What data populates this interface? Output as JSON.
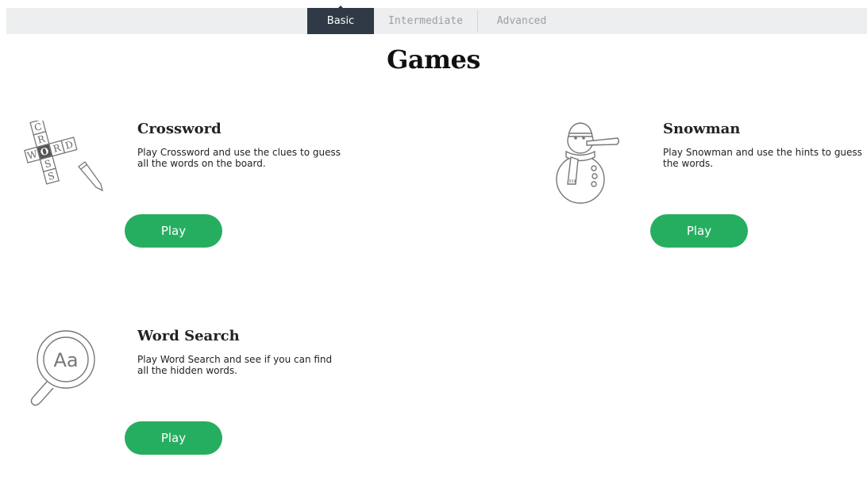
{
  "tabs": [
    {
      "label": "Basic",
      "active": true
    },
    {
      "label": "Intermediate",
      "active": false
    },
    {
      "label": "Advanced",
      "active": false
    }
  ],
  "page_title": "Games",
  "games": [
    {
      "title": "Crossword",
      "description": "Play Crossword and use the clues to guess all the words on the board.",
      "button_label": "Play",
      "icon": "crossword-icon",
      "icon_letters": {
        "vertical": [
          "C",
          "R",
          "O",
          "S",
          "S"
        ],
        "horizontal": [
          "W",
          "O",
          "R",
          "D"
        ]
      }
    },
    {
      "title": "Snowman",
      "description": "Play Snowman and use the hints to guess the words.",
      "button_label": "Play",
      "icon": "snowman-icon"
    },
    {
      "title": "Word Search",
      "description": "Play Word Search and see if you can find all the hidden words.",
      "button_label": "Play",
      "icon": "magnifier-icon",
      "icon_text": "Aa"
    }
  ],
  "colors": {
    "top_bar": "#eceeef",
    "active_tab": "#2f3a46",
    "play_button": "#26ae60",
    "icon_stroke": "#777777"
  }
}
